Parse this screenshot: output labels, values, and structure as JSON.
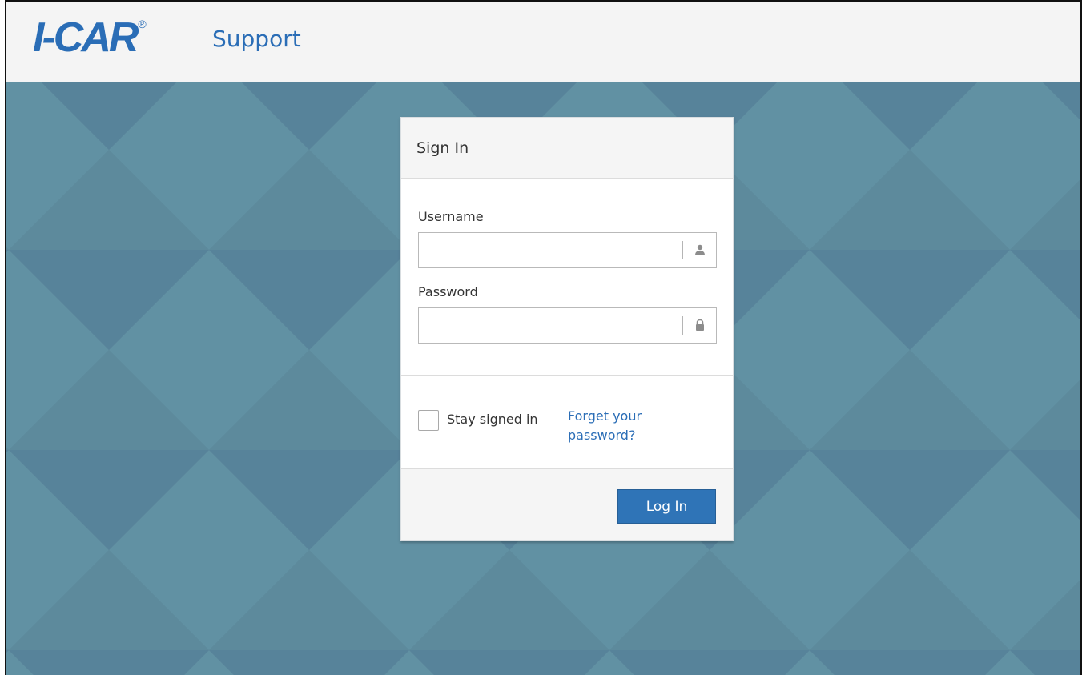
{
  "header": {
    "logo_text": "I-CAR",
    "logo_reg": "®",
    "brand_sub": "Support",
    "brand_color": "#2a6db6"
  },
  "background": {
    "color": "#5b8799"
  },
  "login": {
    "title": "Sign In",
    "username_label": "Username",
    "username_value": "",
    "username_icon": "user-icon",
    "password_label": "Password",
    "password_value": "",
    "password_icon": "lock-icon",
    "stay_signed_in_label": "Stay signed in",
    "stay_signed_in_checked": false,
    "forgot_link": "Forget your password?",
    "login_button": "Log In",
    "button_color": "#2f74b7"
  }
}
